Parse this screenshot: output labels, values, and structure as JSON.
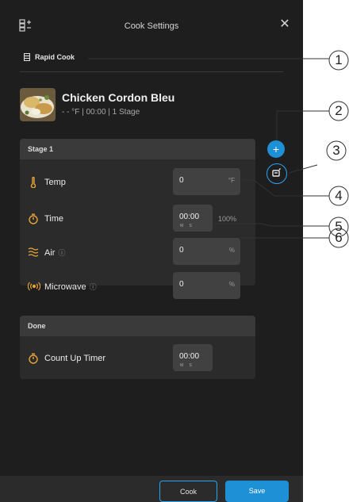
{
  "header": {
    "title": "Cook Settings",
    "close_glyph": "✕",
    "menu_icon": "program-list-icon"
  },
  "mode": {
    "label": "Rapid Cook",
    "icon": "oven-icon"
  },
  "recipe": {
    "name": "Chicken Cordon Bleu",
    "meta": "- - °F | 00:00 | 1 Stage"
  },
  "stage": {
    "header": "Stage 1",
    "temp": {
      "label": "Temp",
      "value": "0",
      "unit": "°F",
      "icon": "thermometer-icon"
    },
    "time": {
      "label": "Time",
      "value": "00:00",
      "sub": "M S",
      "percent": "100%",
      "icon": "timer-icon"
    },
    "air": {
      "label": "Air",
      "value": "0",
      "unit": "%",
      "info": "ⓘ",
      "icon": "air-waves-icon"
    },
    "microwave": {
      "label": "Microwave",
      "value": "0",
      "unit": "%",
      "info": "ⓘ",
      "icon": "microwave-icon"
    }
  },
  "done": {
    "header": "Done",
    "count_up": {
      "label": "Count Up Timer",
      "value": "00:00",
      "sub": "M S",
      "icon": "timer-icon"
    }
  },
  "fab": {
    "add_glyph": "+",
    "note_icon": "note-edit-icon"
  },
  "footer": {
    "cook": "Cook",
    "save": "Save"
  },
  "callouts": [
    "1",
    "2",
    "3",
    "4",
    "5",
    "6"
  ],
  "colors": {
    "accent": "#1e90d6",
    "icon_orange": "#e7a53a",
    "background": "#1e1e1e",
    "panel": "#2b2b2b"
  }
}
